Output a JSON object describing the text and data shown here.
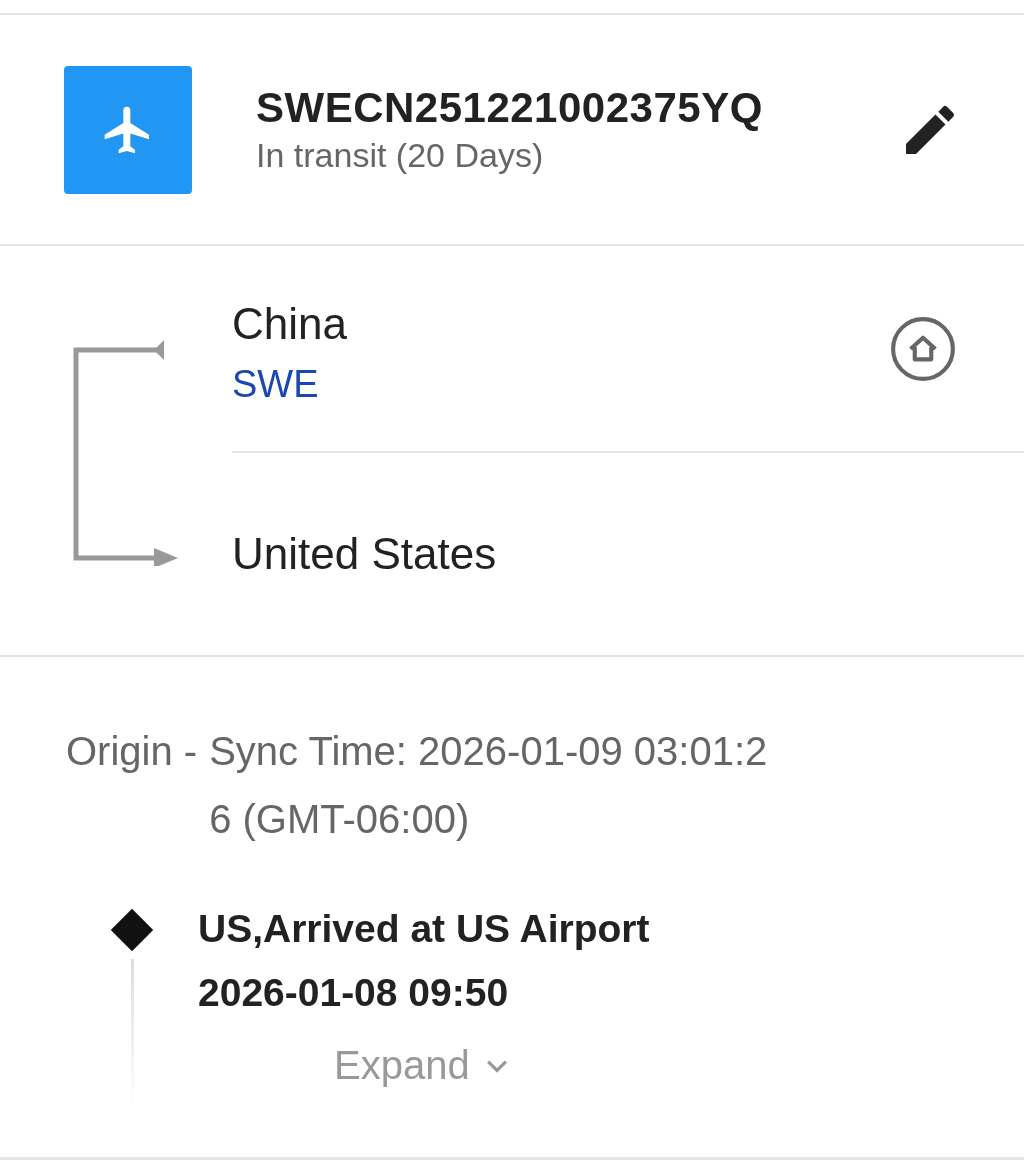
{
  "shipment": {
    "tracking_number": "SWECN251221002375YQ",
    "status": "In transit (20 Days)"
  },
  "route": {
    "origin": "China",
    "carrier": "SWE",
    "destination": "United States"
  },
  "sync": {
    "source": "Origin -",
    "time": "Sync Time: 2026-01-09 03:01:26 (GMT-06:00)"
  },
  "events": [
    {
      "description": "US,Arrived at US Airport",
      "time": "2026-01-08 09:50"
    }
  ],
  "expand": {
    "label": "Expand",
    "expanded": false
  }
}
